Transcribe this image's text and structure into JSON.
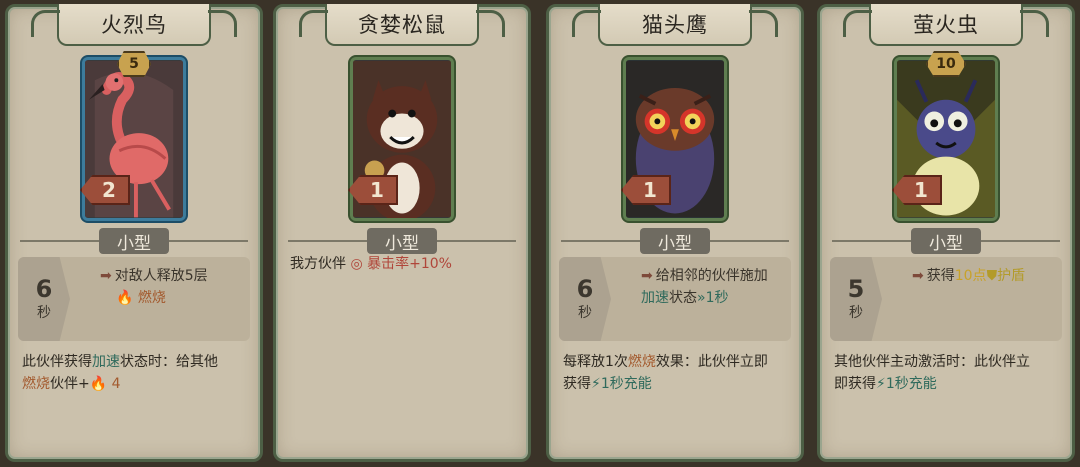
{
  "cards": [
    {
      "title": "火烈鸟",
      "level": "5",
      "cost": "2",
      "size": "小型",
      "cooldown": "6",
      "cooldown_unit": "秒",
      "ability_line1": "对敌人释放5层",
      "ability_kw": "燃烧",
      "desc_a": "此伙伴获得",
      "desc_kw": "加速",
      "desc_b": "状态时：给其他",
      "desc_c_kw": "燃烧",
      "desc_c": "伙伴+",
      "desc_num": "4"
    },
    {
      "title": "贪婪松鼠",
      "cost": "1",
      "size": "小型",
      "line_a": "我方伙伴",
      "line_kw": "暴击率",
      "line_val": "+10%"
    },
    {
      "title": "猫头鹰",
      "cost": "1",
      "size": "小型",
      "cooldown": "6",
      "cooldown_unit": "秒",
      "ability_line1": "给相邻的伙伴施加",
      "ability_kw": "加速",
      "ability_b": "状态",
      "ability_val": "1秒",
      "desc_a": "每释放1次",
      "desc_kw": "燃烧",
      "desc_b": "效果：此伙伴立即",
      "desc_c": "获得",
      "desc_val": "1秒",
      "desc_kw2": "充能"
    },
    {
      "title": "萤火虫",
      "level": "10",
      "cost": "1",
      "size": "小型",
      "cooldown": "5",
      "cooldown_unit": "秒",
      "ability_a": "获得",
      "ability_num": "10点",
      "ability_kw": "护盾",
      "desc_a": "其他伙伴主动激活时：此伙伴立",
      "desc_b": "即获得",
      "desc_val": "1秒",
      "desc_kw": "充能"
    }
  ]
}
